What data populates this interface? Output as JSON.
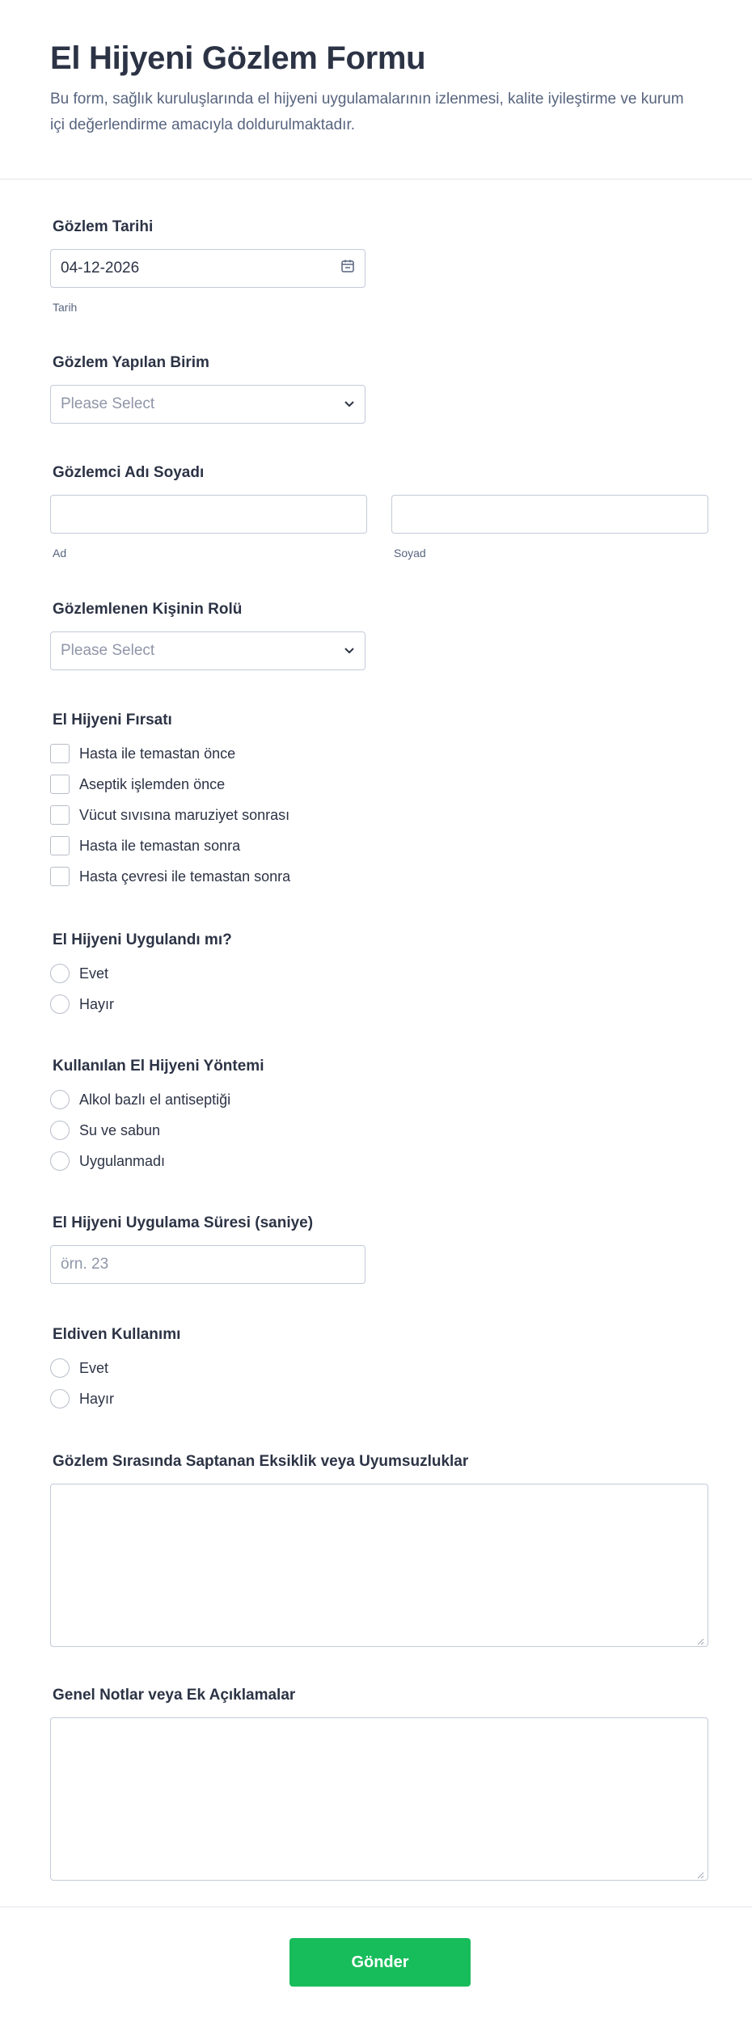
{
  "header": {
    "title": "El Hijyeni Gözlem Formu",
    "description": "Bu form, sağlık kuruluşlarında el hijyeni uygulamalarının izlenmesi, kalite iyileştirme ve kurum içi değerlendirme amacıyla doldurulmaktadır."
  },
  "observation_date": {
    "label": "Gözlem Tarihi",
    "value": "04-12-2026",
    "sublabel": "Tarih",
    "icon": "calendar-icon"
  },
  "unit": {
    "label": "Gözlem Yapılan Birim",
    "placeholder": "Please Select",
    "icon": "chevron-down-icon"
  },
  "observer": {
    "label": "Gözlemci Adı Soyadı",
    "first_sublabel": "Ad",
    "last_sublabel": "Soyad"
  },
  "role": {
    "label": "Gözlemlenen Kişinin Rolü",
    "placeholder": "Please Select",
    "icon": "chevron-down-icon"
  },
  "opportunity": {
    "label": "El Hijyeni Fırsatı",
    "options": [
      "Hasta ile temastan önce",
      "Aseptik işlemden önce",
      "Vücut sıvısına maruziyet sonrası",
      "Hasta ile temastan sonra",
      "Hasta çevresi ile temastan sonra"
    ]
  },
  "applied": {
    "label": "El Hijyeni Uygulandı mı?",
    "options": [
      "Evet",
      "Hayır"
    ]
  },
  "method": {
    "label": "Kullanılan El Hijyeni Yöntemi",
    "options": [
      "Alkol bazlı el antiseptiği",
      "Su ve sabun",
      "Uygulanmadı"
    ]
  },
  "duration": {
    "label": "El Hijyeni Uygulama Süresi (saniye)",
    "placeholder": "örn. 23"
  },
  "gloves": {
    "label": "Eldiven Kullanımı",
    "options": [
      "Evet",
      "Hayır"
    ]
  },
  "deficiencies": {
    "label": "Gözlem Sırasında Saptanan Eksiklik veya Uyumsuzluklar"
  },
  "notes": {
    "label": "Genel Notlar veya Ek Açıklamalar"
  },
  "submit": {
    "label": "Gönder",
    "color": "#18bd5b"
  }
}
